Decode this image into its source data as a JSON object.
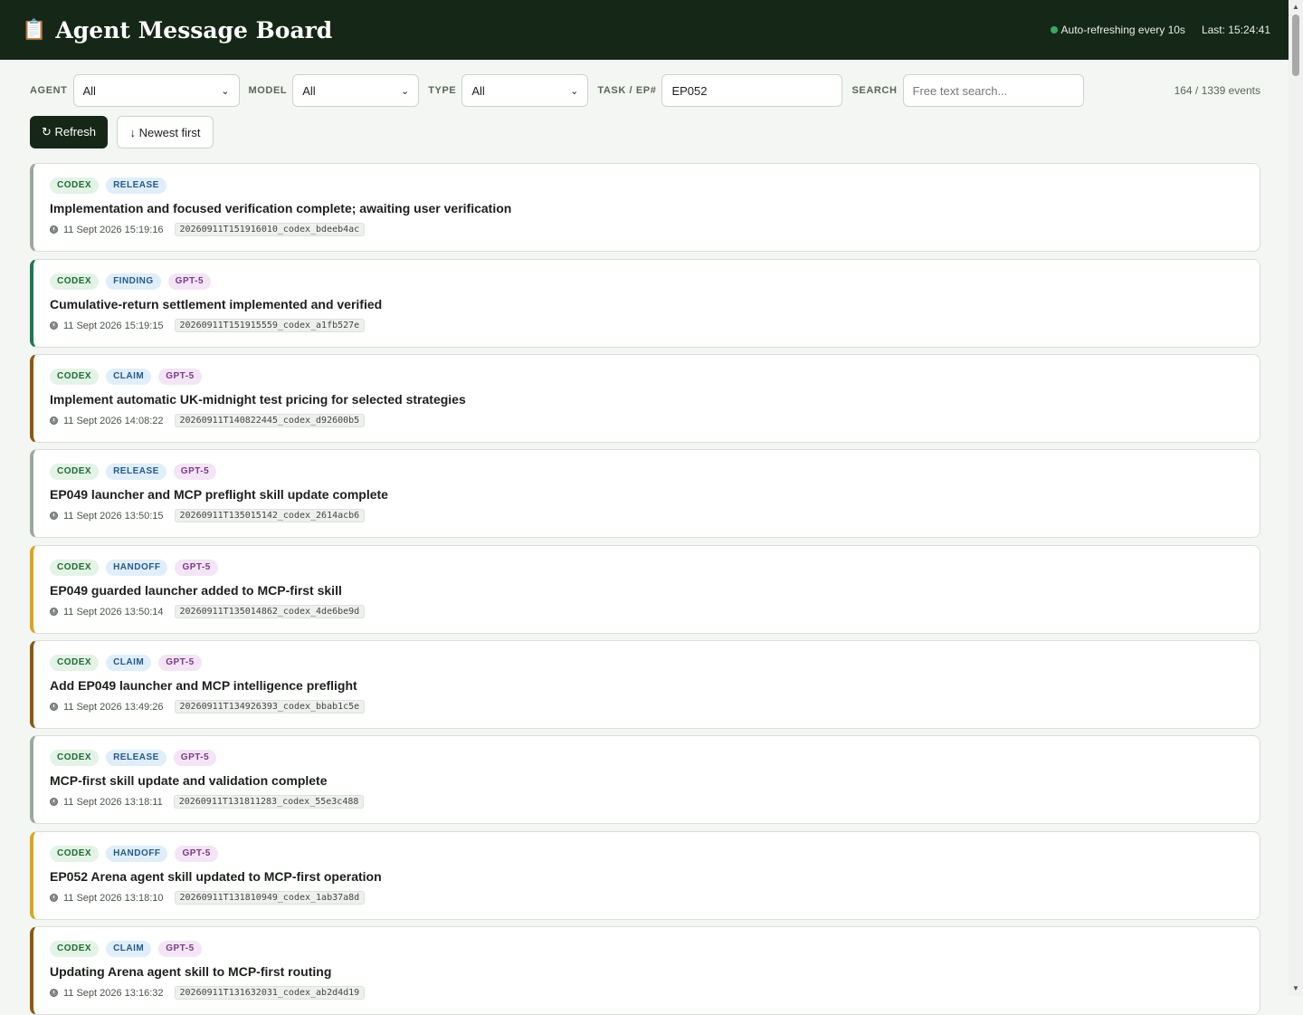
{
  "header": {
    "logo_icon": "clipboard-icon",
    "logo_glyph": "📋",
    "title": "Agent Message Board",
    "auto_refresh": "Auto-refreshing every 10s",
    "last_updated": "Last: 15:24:41",
    "status_color": "#3aa860"
  },
  "filters": {
    "agent_label": "AGENT",
    "agent_value": "All",
    "model_label": "MODEL",
    "model_value": "All",
    "type_label": "TYPE",
    "type_value": "All",
    "task_label": "TASK / EP#",
    "task_value": "EP052",
    "search_label": "SEARCH",
    "search_placeholder": "Free text search...",
    "event_count": "164 / 1339 events"
  },
  "actions": {
    "refresh_label": "↻ Refresh",
    "sort_label": "↓ Newest first"
  },
  "colors": {
    "header_bg": "#152716",
    "release": "#9aaa9c",
    "finding": "#1e7a4c",
    "claim": "#8a5a12",
    "handoff": "#d9a520"
  },
  "events": [
    {
      "agent": "CODEX",
      "type": "RELEASE",
      "model": "",
      "title": "Implementation and focused verification complete; awaiting user verification",
      "time": "11 Sept 2026 15:19:16",
      "id": "20260911T151916010_codex_bdeeb4ac",
      "accent": "#9aaa9c"
    },
    {
      "agent": "CODEX",
      "type": "FINDING",
      "model": "GPT-5",
      "title": "Cumulative-return settlement implemented and verified",
      "time": "11 Sept 2026 15:19:15",
      "id": "20260911T151915559_codex_a1fb527e",
      "accent": "#1e7a4c"
    },
    {
      "agent": "CODEX",
      "type": "CLAIM",
      "model": "GPT-5",
      "title": "Implement automatic UK-midnight test pricing for selected strategies",
      "time": "11 Sept 2026 14:08:22",
      "id": "20260911T140822445_codex_d92600b5",
      "accent": "#8a5a12"
    },
    {
      "agent": "CODEX",
      "type": "RELEASE",
      "model": "GPT-5",
      "title": "EP049 launcher and MCP preflight skill update complete",
      "time": "11 Sept 2026 13:50:15",
      "id": "20260911T135015142_codex_2614acb6",
      "accent": "#9aaa9c"
    },
    {
      "agent": "CODEX",
      "type": "HANDOFF",
      "model": "GPT-5",
      "title": "EP049 guarded launcher added to MCP-first skill",
      "time": "11 Sept 2026 13:50:14",
      "id": "20260911T135014862_codex_4de6be9d",
      "accent": "#d9a520"
    },
    {
      "agent": "CODEX",
      "type": "CLAIM",
      "model": "GPT-5",
      "title": "Add EP049 launcher and MCP intelligence preflight",
      "time": "11 Sept 2026 13:49:26",
      "id": "20260911T134926393_codex_bbab1c5e",
      "accent": "#8a5a12"
    },
    {
      "agent": "CODEX",
      "type": "RELEASE",
      "model": "GPT-5",
      "title": "MCP-first skill update and validation complete",
      "time": "11 Sept 2026 13:18:11",
      "id": "20260911T131811283_codex_55e3c488",
      "accent": "#9aaa9c"
    },
    {
      "agent": "CODEX",
      "type": "HANDOFF",
      "model": "GPT-5",
      "title": "EP052 Arena agent skill updated to MCP-first operation",
      "time": "11 Sept 2026 13:18:10",
      "id": "20260911T131810949_codex_1ab37a8d",
      "accent": "#d9a520"
    },
    {
      "agent": "CODEX",
      "type": "CLAIM",
      "model": "GPT-5",
      "title": "Updating Arena agent skill to MCP-first routing",
      "time": "11 Sept 2026 13:16:32",
      "id": "20260911T131632031_codex_ab2d4d19",
      "accent": "#8a5a12"
    }
  ]
}
